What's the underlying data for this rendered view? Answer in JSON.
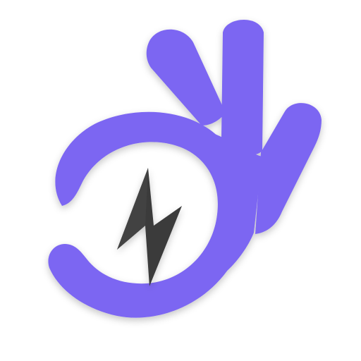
{
  "icon": {
    "name": "ok-hand-lightning-icon",
    "hand_color": "#7B66F2",
    "hand_shadow_color": "#6450D9",
    "bolt_color": "#3A3A3A",
    "bolt_highlight": "#4A4A4A",
    "background": "#FFFFFF"
  }
}
